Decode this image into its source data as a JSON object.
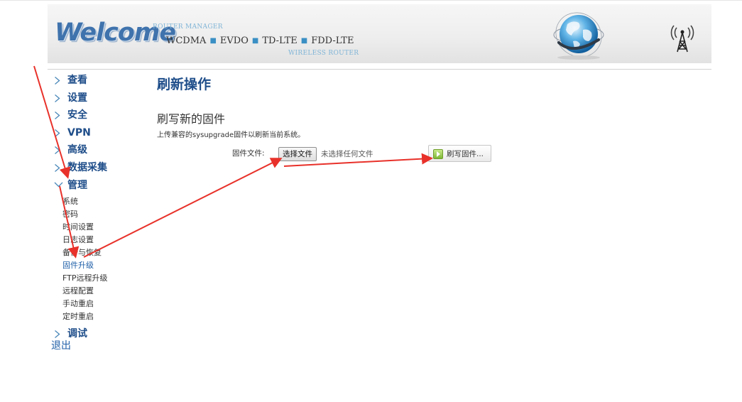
{
  "header": {
    "logo_text": "Welcome",
    "top_label": "ROUTER MANAGER",
    "technologies": [
      "WCDMA",
      "EVDO",
      "TD-LTE",
      "FDD-LTE"
    ],
    "bottom_label": "WIRELESS ROUTER",
    "globe_icon": "globe-icon",
    "tower_icon": "antenna-tower-icon"
  },
  "sidebar": {
    "items": [
      {
        "label": "查看"
      },
      {
        "label": "设置"
      },
      {
        "label": "安全"
      },
      {
        "label": "VPN"
      },
      {
        "label": "高级"
      },
      {
        "label": "数据采集"
      },
      {
        "label": "管理",
        "expanded": true
      },
      {
        "label": "调试"
      }
    ],
    "submenu": [
      {
        "label": "系统"
      },
      {
        "label": "密码"
      },
      {
        "label": "时间设置"
      },
      {
        "label": "日志设置"
      },
      {
        "label": "备份与恢复"
      },
      {
        "label": "固件升级",
        "active": true
      },
      {
        "label": "FTP远程升级"
      },
      {
        "label": "远程配置"
      },
      {
        "label": "手动重启"
      },
      {
        "label": "定时重启"
      }
    ],
    "logout": "退出"
  },
  "main": {
    "title": "刷新操作",
    "section_title": "刷写新的固件",
    "description": "上传兼容的sysupgrade固件以刷新当前系统。",
    "file_label": "固件文件:",
    "choose_button": "选择文件",
    "file_status": "未选择任何文件",
    "flash_button": "刷写固件..."
  },
  "colors": {
    "brand_blue": "#1f4e8a",
    "link_blue": "#1f5fa8",
    "annotation_red": "#e8312a",
    "flash_icon_green": "#7db735"
  }
}
